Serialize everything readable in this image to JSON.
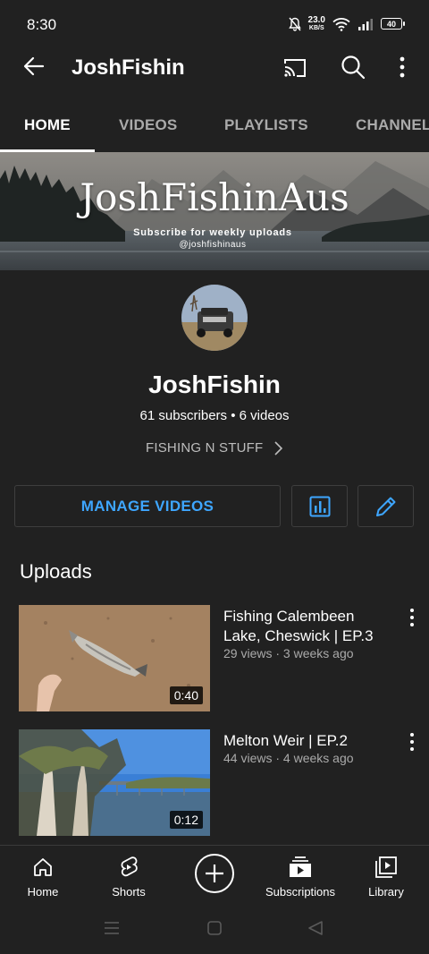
{
  "status_bar": {
    "time": "8:30",
    "speed_value": "23.0",
    "speed_unit": "KB/S",
    "battery": "40"
  },
  "app_bar": {
    "title": "JoshFishin"
  },
  "tabs": [
    {
      "label": "HOME",
      "active": true
    },
    {
      "label": "VIDEOS",
      "active": false
    },
    {
      "label": "PLAYLISTS",
      "active": false
    },
    {
      "label": "CHANNEL",
      "active": false
    }
  ],
  "banner": {
    "title": "JoshFishinAus",
    "subtitle": "Subscribe for weekly uploads",
    "handle": "@joshfishinaus"
  },
  "channel": {
    "name": "JoshFishin",
    "stats": "61 subscribers • 6 videos",
    "link_label": "FISHING N STUFF"
  },
  "actions": {
    "manage_label": "MANAGE VIDEOS",
    "analytics_icon": "bar-chart-icon",
    "edit_icon": "pencil-icon"
  },
  "uploads": {
    "heading": "Uploads",
    "videos": [
      {
        "title": "Fishing Calembeen Lake, Cheswick | EP.3",
        "meta": "29 views · 3 weeks ago",
        "duration": "0:40"
      },
      {
        "title": "Melton Weir | EP.2",
        "meta": "44 views · 4 weeks ago",
        "duration": "0:12"
      }
    ]
  },
  "bottom_nav": {
    "items": [
      {
        "label": "Home",
        "icon": "home-icon"
      },
      {
        "label": "Shorts",
        "icon": "shorts-icon"
      },
      {
        "label": "",
        "icon": "create-icon"
      },
      {
        "label": "Subscriptions",
        "icon": "subscriptions-icon"
      },
      {
        "label": "Library",
        "icon": "library-icon"
      }
    ]
  },
  "colors": {
    "background": "#212121",
    "accent_blue": "#3ea6ff",
    "secondary_text": "#aaaaaa",
    "border": "#3e3e3e"
  }
}
